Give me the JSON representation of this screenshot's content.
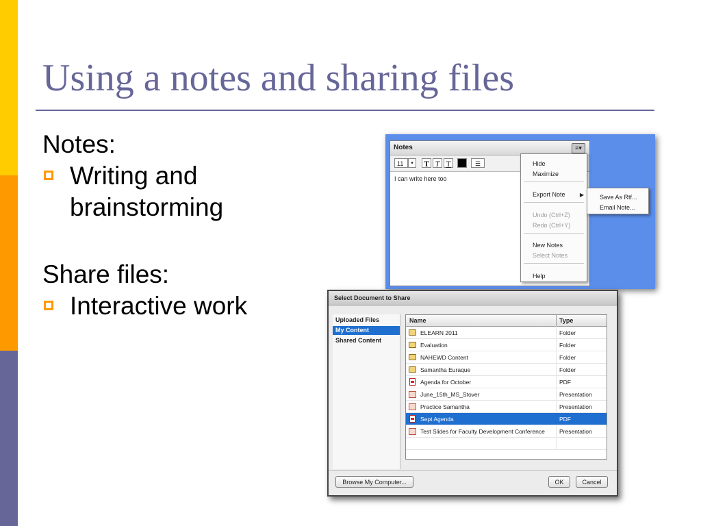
{
  "slide": {
    "title": "Using a notes and sharing files",
    "notes_heading": "Notes:",
    "notes_bullet": "Writing and brainstorming",
    "share_heading": "Share files:",
    "share_bullet": "Interactive work",
    "colors": {
      "title": "#666699",
      "bar_top": "#FFCC00",
      "bar_mid": "#FF9900",
      "bar_bottom": "#666699",
      "bullet": "#FF9900"
    }
  },
  "notes_pod": {
    "title": "Notes",
    "menu_button_icon": "≡▾",
    "font_size": "11",
    "text": "I can write here too",
    "menu": {
      "hide": "Hide",
      "maximize": "Maximize",
      "export_note": "Export Note",
      "undo": "Undo (Ctrl+Z)",
      "redo": "Redo (Ctrl+Y)",
      "new_notes": "New Notes",
      "select_notes": "Select Notes",
      "help": "Help"
    },
    "submenu": {
      "save_as_rtf": "Save As Rtf...",
      "email_note": "Email Note..."
    }
  },
  "share_dialog": {
    "title": "Select Document to Share",
    "nav": [
      "Uploaded Files",
      "My Content",
      "Shared Content"
    ],
    "selected_nav": "My Content",
    "columns": {
      "name": "Name",
      "type": "Type"
    },
    "rows": [
      {
        "name": "ELEARN 2011",
        "type": "Folder",
        "icon": "folder-icon"
      },
      {
        "name": "Evaluation",
        "type": "Folder",
        "icon": "folder-icon"
      },
      {
        "name": "NAHEWD Content",
        "type": "Folder",
        "icon": "folder-icon"
      },
      {
        "name": "Samantha Euraque",
        "type": "Folder",
        "icon": "folder-icon"
      },
      {
        "name": "Agenda for October",
        "type": "PDF",
        "icon": "pdf-icon"
      },
      {
        "name": "June_15th_MS_Stover",
        "type": "Presentation",
        "icon": "presentation-icon"
      },
      {
        "name": "Practice Samantha",
        "type": "Presentation",
        "icon": "presentation-icon"
      },
      {
        "name": "Sept Agenda",
        "type": "PDF",
        "icon": "pdf-icon",
        "selected": true
      },
      {
        "name": "Test Slides for Faculty Development Conference",
        "type": "Presentation",
        "icon": "presentation-icon"
      }
    ],
    "buttons": {
      "browse": "Browse My Computer...",
      "ok": "OK",
      "cancel": "Cancel"
    },
    "colors": {
      "selection": "#1F6FD0"
    }
  }
}
